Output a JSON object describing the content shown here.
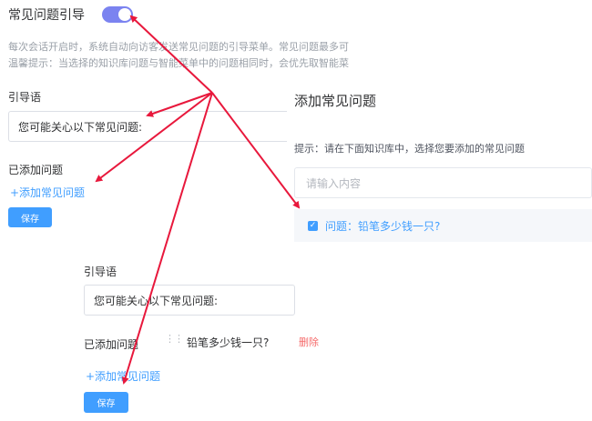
{
  "header": {
    "title": "常见问题引导",
    "toggle_on": true,
    "accent": "#7b83f0"
  },
  "description": {
    "line1": "每次会话开启时，系统自动向访客发送常见问题的引导菜单。常见问题最多可",
    "line2": "温馨提示：当选择的知识库问题与智能菜单中的问题相同时，会优先取智能菜"
  },
  "top_form": {
    "guide_label": "引导语",
    "guide_value": "您可能关心以下常见问题:",
    "added_label": "已添加问题",
    "add_link": "+添加常见问题",
    "save_label": "保存"
  },
  "dialog": {
    "title": "添加常见问题",
    "tip": "提示：请在下面知识库中，选择您要添加的常见问题",
    "search_placeholder": "请输入内容",
    "result_item": "问题：铅笔多少钱一只?",
    "result_checked": true
  },
  "bottom_form": {
    "guide_label": "引导语",
    "guide_value": "您可能关心以下常见问题:",
    "added_label": "已添加问题",
    "drag_handle": "⋮⋮",
    "added_item": "铅笔多少钱一只?",
    "delete_label": "删除",
    "add_link": "+添加常见问题",
    "save_label": "保存"
  },
  "colors": {
    "primary": "#409eff",
    "danger": "#f56c6c",
    "annotation_arrow": "#e8183c"
  },
  "icons": {
    "checkbox": "check-icon",
    "drag": "drag-handle-icon"
  }
}
